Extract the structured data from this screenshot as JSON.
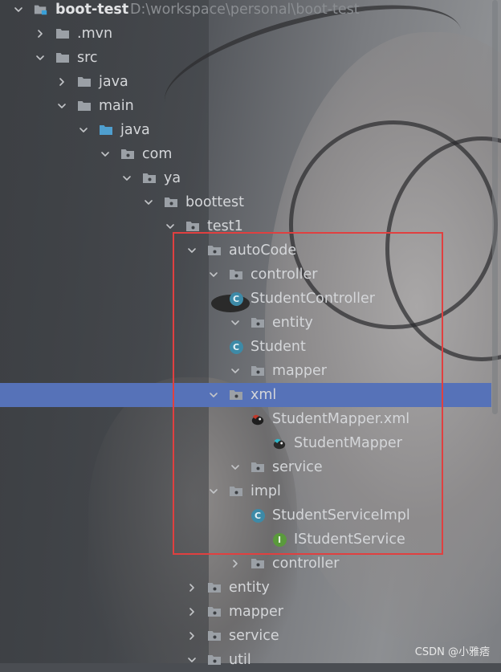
{
  "project": {
    "name": "boot-test",
    "path": "D:\\workspace\\personal\\boot-test"
  },
  "nodes": [
    {
      "label": "boot-test",
      "kind": "project",
      "expanded": true
    },
    {
      "label": ".mvn",
      "kind": "folder",
      "expanded": false
    },
    {
      "label": "src",
      "kind": "folder",
      "expanded": true
    },
    {
      "label": "java",
      "kind": "folder",
      "expanded": false
    },
    {
      "label": "main",
      "kind": "folder",
      "expanded": true
    },
    {
      "label": "java",
      "kind": "source-folder",
      "expanded": true
    },
    {
      "label": "com",
      "kind": "package",
      "expanded": true
    },
    {
      "label": "ya",
      "kind": "package",
      "expanded": true
    },
    {
      "label": "boottest",
      "kind": "package",
      "expanded": true
    },
    {
      "label": "test1",
      "kind": "package",
      "expanded": true
    },
    {
      "label": "autoCode",
      "kind": "package",
      "expanded": true
    },
    {
      "label": "controller",
      "kind": "package",
      "expanded": true
    },
    {
      "label": "StudentController",
      "kind": "class"
    },
    {
      "label": "entity",
      "kind": "package",
      "expanded": true
    },
    {
      "label": "Student",
      "kind": "class"
    },
    {
      "label": "mapper",
      "kind": "package",
      "expanded": true
    },
    {
      "label": "xml",
      "kind": "package",
      "expanded": true,
      "selected": true
    },
    {
      "label": "StudentMapper.xml",
      "kind": "mybatis-xml"
    },
    {
      "label": "StudentMapper",
      "kind": "mybatis-mapper"
    },
    {
      "label": "service",
      "kind": "package",
      "expanded": true
    },
    {
      "label": "impl",
      "kind": "package",
      "expanded": true
    },
    {
      "label": "StudentServiceImpl",
      "kind": "class"
    },
    {
      "label": "IStudentService",
      "kind": "interface"
    },
    {
      "label": "controller",
      "kind": "package",
      "expanded": false
    },
    {
      "label": "entity",
      "kind": "package",
      "expanded": false
    },
    {
      "label": "mapper",
      "kind": "package",
      "expanded": false
    },
    {
      "label": "service",
      "kind": "package",
      "expanded": false
    },
    {
      "label": "util",
      "kind": "package",
      "expanded": true
    }
  ],
  "icons": {
    "class_letter": "C",
    "interface_letter": "I"
  },
  "colors": {
    "selection": "#5672b8",
    "highlight_box": "#e04040",
    "class_icon": "#3d8aa7",
    "interface_icon": "#5a9a3c"
  },
  "watermark": "CSDN @小雅痞"
}
